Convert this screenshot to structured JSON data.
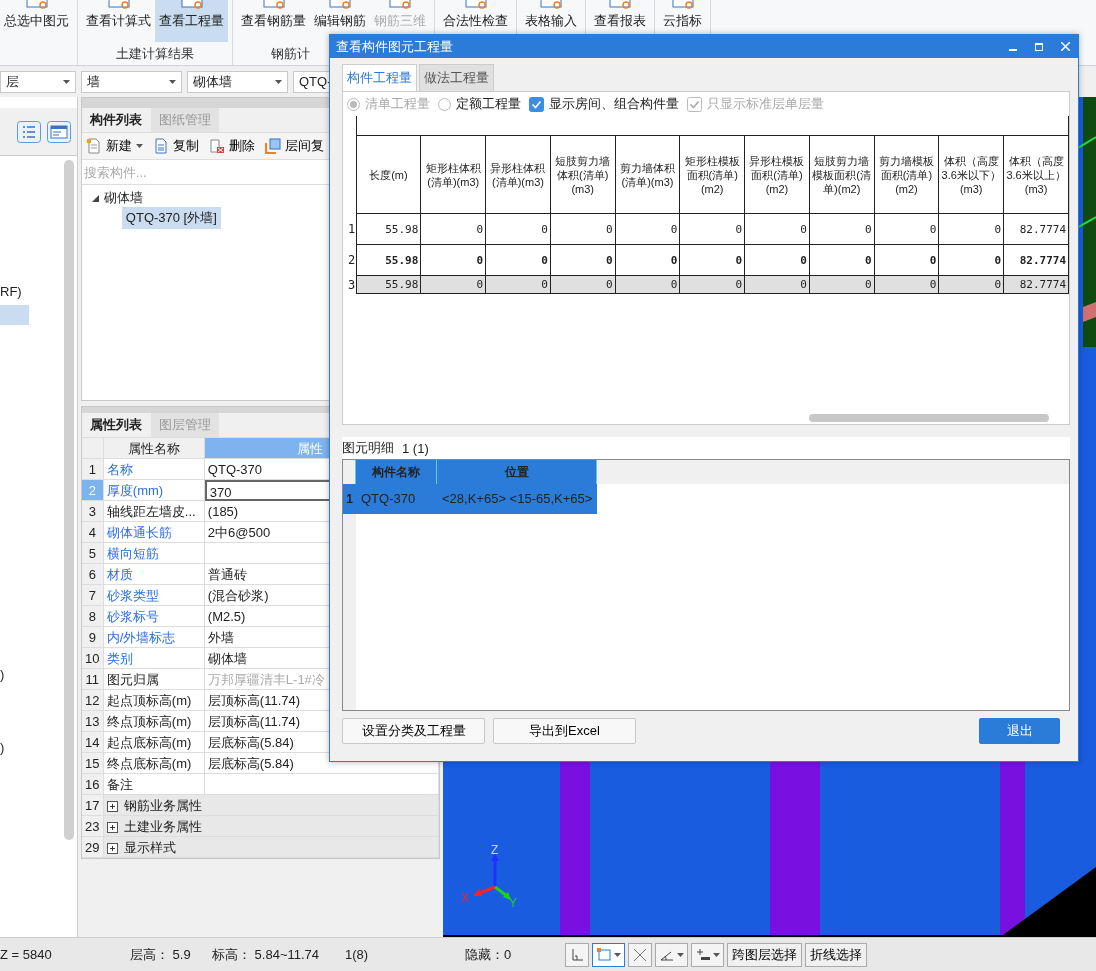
{
  "ribbon": {
    "groups": [
      {
        "buttons": [
          {
            "label": "总选中图元",
            "selected": false,
            "disabled": false
          }
        ]
      },
      {
        "label": "土建计算结果",
        "buttons": [
          {
            "label": "查看计算式",
            "selected": false,
            "disabled": false
          },
          {
            "label": "查看工程量",
            "selected": true,
            "disabled": false
          }
        ]
      },
      {
        "label": "钢筋计",
        "buttons": [
          {
            "label": "查看钢筋量",
            "selected": false,
            "disabled": false
          },
          {
            "label": "编辑钢筋",
            "selected": false,
            "disabled": false
          },
          {
            "label": "钢筋三维",
            "selected": false,
            "disabled": true
          }
        ]
      },
      {
        "buttons": [
          {
            "label": "合法性检查",
            "selected": false,
            "disabled": false
          }
        ]
      },
      {
        "buttons": [
          {
            "label": "表格输入",
            "selected": false,
            "disabled": false
          }
        ]
      },
      {
        "buttons": [
          {
            "label": "查看报表",
            "selected": false,
            "disabled": false
          }
        ]
      },
      {
        "buttons": [
          {
            "label": "云指标",
            "selected": false,
            "disabled": false
          }
        ]
      }
    ]
  },
  "selectors": [
    "层",
    "墙",
    "砌体墙",
    "QTQ-"
  ],
  "left_panel": {
    "rows": [
      {
        "text": "RF)",
        "selected": false
      },
      {
        "selected": true
      },
      {
        "text": ")",
        "selected": false
      },
      {
        "text": ")",
        "selected": false
      }
    ]
  },
  "component_panel": {
    "tabs": [
      {
        "label": "构件列表",
        "selected": true
      },
      {
        "label": "图纸管理",
        "selected": false
      }
    ],
    "toolbar": [
      {
        "label": "新建",
        "menu": true
      },
      {
        "label": "复制",
        "menu": false
      },
      {
        "label": "删除",
        "menu": false
      },
      {
        "label": "层间复",
        "menu": false
      }
    ],
    "search": {
      "placeholder": "搜索构件..."
    },
    "tree": [
      {
        "label": "砌体墙",
        "expanded": true,
        "selected": false,
        "children": [
          {
            "label": "QTQ-370 [外墙]",
            "selected": true
          }
        ]
      }
    ]
  },
  "property_panel": {
    "tabs": [
      {
        "label": "属性列表",
        "selected": true
      },
      {
        "label": "图层管理",
        "selected": false
      }
    ],
    "columns": [
      "属性名称",
      "属性"
    ],
    "rows": [
      {
        "number": "1",
        "name": "名称",
        "value": "QTQ-370",
        "kind": "public",
        "selected": false
      },
      {
        "number": "2",
        "name": "厚度(mm)",
        "value": "370",
        "kind": "public",
        "selected": true
      },
      {
        "number": "3",
        "name": "轴线距左墙皮...",
        "value": "(185)",
        "kind": "private",
        "selected": false
      },
      {
        "number": "4",
        "name": "砌体通长筋",
        "value": "2中6@500",
        "kind": "public",
        "selected": false
      },
      {
        "number": "5",
        "name": "横向短筋",
        "kind": "public",
        "selected": false
      },
      {
        "number": "6",
        "name": "材质",
        "value": "普通砖",
        "kind": "public",
        "selected": false
      },
      {
        "number": "7",
        "name": "砂浆类型",
        "value": "(混合砂浆)",
        "kind": "public",
        "selected": false
      },
      {
        "number": "8",
        "name": "砂浆标号",
        "value": "(M2.5)",
        "kind": "public",
        "selected": false
      },
      {
        "number": "9",
        "name": "内/外墙标志",
        "value": "外墙",
        "kind": "public",
        "selected": false
      },
      {
        "number": "10",
        "name": "类别",
        "value": "砌体墙",
        "kind": "public",
        "selected": false
      },
      {
        "number": "11",
        "name": "图元归属",
        "value": "万邦厚疆清丰L-1#冷",
        "kind": "readonly",
        "selected": false
      },
      {
        "number": "12",
        "name": "起点顶标高(m)",
        "value": "层顶标高(11.74)",
        "kind": "private",
        "selected": false
      },
      {
        "number": "13",
        "name": "终点顶标高(m)",
        "value": "层顶标高(11.74)",
        "kind": "private",
        "selected": false
      },
      {
        "number": "14",
        "name": "起点底标高(m)",
        "value": "层底标高(5.84)",
        "kind": "private",
        "selected": false
      },
      {
        "number": "15",
        "name": "终点底标高(m)",
        "value": "层底标高(5.84)",
        "kind": "private",
        "selected": false
      },
      {
        "number": "16",
        "name": "备注",
        "kind": "private",
        "selected": false
      },
      {
        "number": "17",
        "name": "钢筋业务属性",
        "kind": "group",
        "selected": false
      },
      {
        "number": "23",
        "name": "土建业务属性",
        "kind": "group",
        "selected": false
      },
      {
        "number": "29",
        "name": "显示样式",
        "kind": "group",
        "selected": false
      }
    ]
  },
  "view": {
    "axes": [
      "X",
      "Y",
      "Z"
    ]
  },
  "dialog": {
    "title": "查看构件图元工程量",
    "tabs": [
      {
        "label": "构件工程量",
        "selected": true
      },
      {
        "label": "做法工程量",
        "selected": false
      }
    ],
    "radios": [
      {
        "label": "清单工程量",
        "selected": true,
        "disabled": true
      },
      {
        "label": "定额工程量",
        "selected": false,
        "disabled": false
      }
    ],
    "checkboxes": [
      {
        "label": "显示房间、组合构件量",
        "checked": true,
        "disabled": false
      },
      {
        "label": "只显示标准层单层量",
        "checked": true,
        "disabled": true
      }
    ],
    "table": {
      "columns": [
        "长度(m)",
        "矩形柱体积(清单)(m3)",
        "异形柱体积(清单)(m3)",
        "短肢剪力墙体积(清单)(m3)",
        "剪力墙体积(清单)(m3)",
        "矩形柱模板面积(清单)(m2)",
        "异形柱模板面积(清单)(m2)",
        "短肢剪力墙模板面积(清单)(m2)",
        "剪力墙模板面积(清单)(m2)",
        "体积（高度3.6米以下）(m3)",
        "体积（高度3.6米以上）(m3)"
      ],
      "rows": [
        {
          "number": "1",
          "kind": "plain",
          "cells": [
            "55.98",
            "0",
            "0",
            "0",
            "0",
            "0",
            "0",
            "0",
            "0",
            "0",
            "82.7774"
          ]
        },
        {
          "number": "2",
          "kind": "bold",
          "cells": [
            "55.98",
            "0",
            "0",
            "0",
            "0",
            "0",
            "0",
            "0",
            "0",
            "0",
            "82.7774"
          ]
        },
        {
          "number": "3",
          "kind": "shaded",
          "cells": [
            "55.98",
            "0",
            "0",
            "0",
            "0",
            "0",
            "0",
            "0",
            "0",
            "0",
            "82.7774"
          ]
        }
      ]
    },
    "detail": {
      "label": "图元明细",
      "count": "1 (1)",
      "columns": [
        "构件名称",
        "位置"
      ],
      "rows": [
        {
          "number": "1",
          "selected": true,
          "cells": [
            "QTQ-370",
            "<28,K+65> <15-65,K+65>"
          ]
        }
      ]
    },
    "buttons": [
      {
        "label": "设置分类及工程量",
        "kind": "normal"
      },
      {
        "label": "导出到Excel",
        "kind": "normal"
      },
      {
        "label": "退出",
        "kind": "primary"
      }
    ]
  },
  "status_bar": {
    "texts": [
      "Z = 5840",
      "层高： 5.9",
      "标高： 5.84~11.74",
      "1(8)",
      "隐藏：0"
    ],
    "tools": [
      {
        "kind": "corner",
        "selected": false,
        "menu": false
      },
      {
        "kind": "rect",
        "selected": true,
        "menu": true
      },
      {
        "kind": "cross",
        "selected": false,
        "menu": false
      },
      {
        "kind": "angle",
        "selected": false,
        "menu": true
      },
      {
        "kind": "plus-line",
        "selected": false,
        "menu": true
      }
    ],
    "buttons": [
      "跨图层选择",
      "折线选择"
    ]
  }
}
